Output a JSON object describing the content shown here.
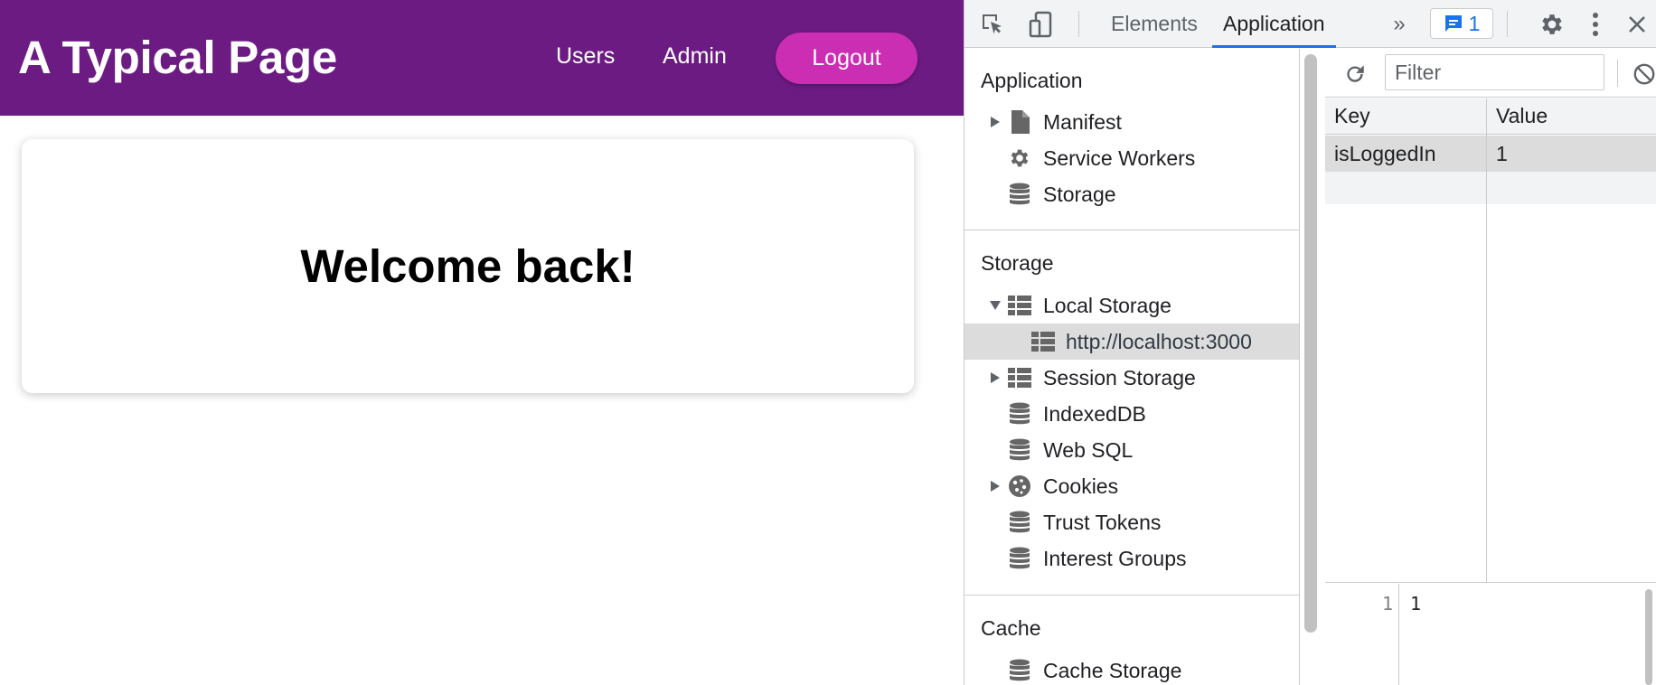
{
  "site": {
    "title": "A Typical Page",
    "nav": {
      "users": "Users",
      "admin": "Admin",
      "logout": "Logout"
    },
    "welcome": "Welcome back!",
    "colors": {
      "header": "#6c1b83",
      "logout_button": "#cc2eb3"
    }
  },
  "devtools": {
    "tabs": {
      "elements": "Elements",
      "application": "Application"
    },
    "issues_count": "1",
    "sidebar": {
      "application_section": "Application",
      "application_items": {
        "manifest": "Manifest",
        "service_workers": "Service Workers",
        "storage": "Storage"
      },
      "storage_section": "Storage",
      "storage_items": {
        "local_storage": "Local Storage",
        "localhost": "http://localhost:3000",
        "session_storage": "Session Storage",
        "indexeddb": "IndexedDB",
        "web_sql": "Web SQL",
        "cookies": "Cookies",
        "trust_tokens": "Trust Tokens",
        "interest_groups": "Interest Groups"
      },
      "cache_section": "Cache",
      "cache_items": {
        "cache_storage": "Cache Storage"
      }
    },
    "main": {
      "filter_placeholder": "Filter",
      "columns": {
        "key": "Key",
        "value": "Value"
      },
      "rows": [
        {
          "key": "isLoggedIn",
          "value": "1"
        }
      ],
      "preview": {
        "line_number": "1",
        "value": "1"
      }
    },
    "colors": {
      "accent": "#1a73e8",
      "toolbar_bg": "#f1f3f4",
      "selected_row": "#dcdcdc"
    }
  }
}
